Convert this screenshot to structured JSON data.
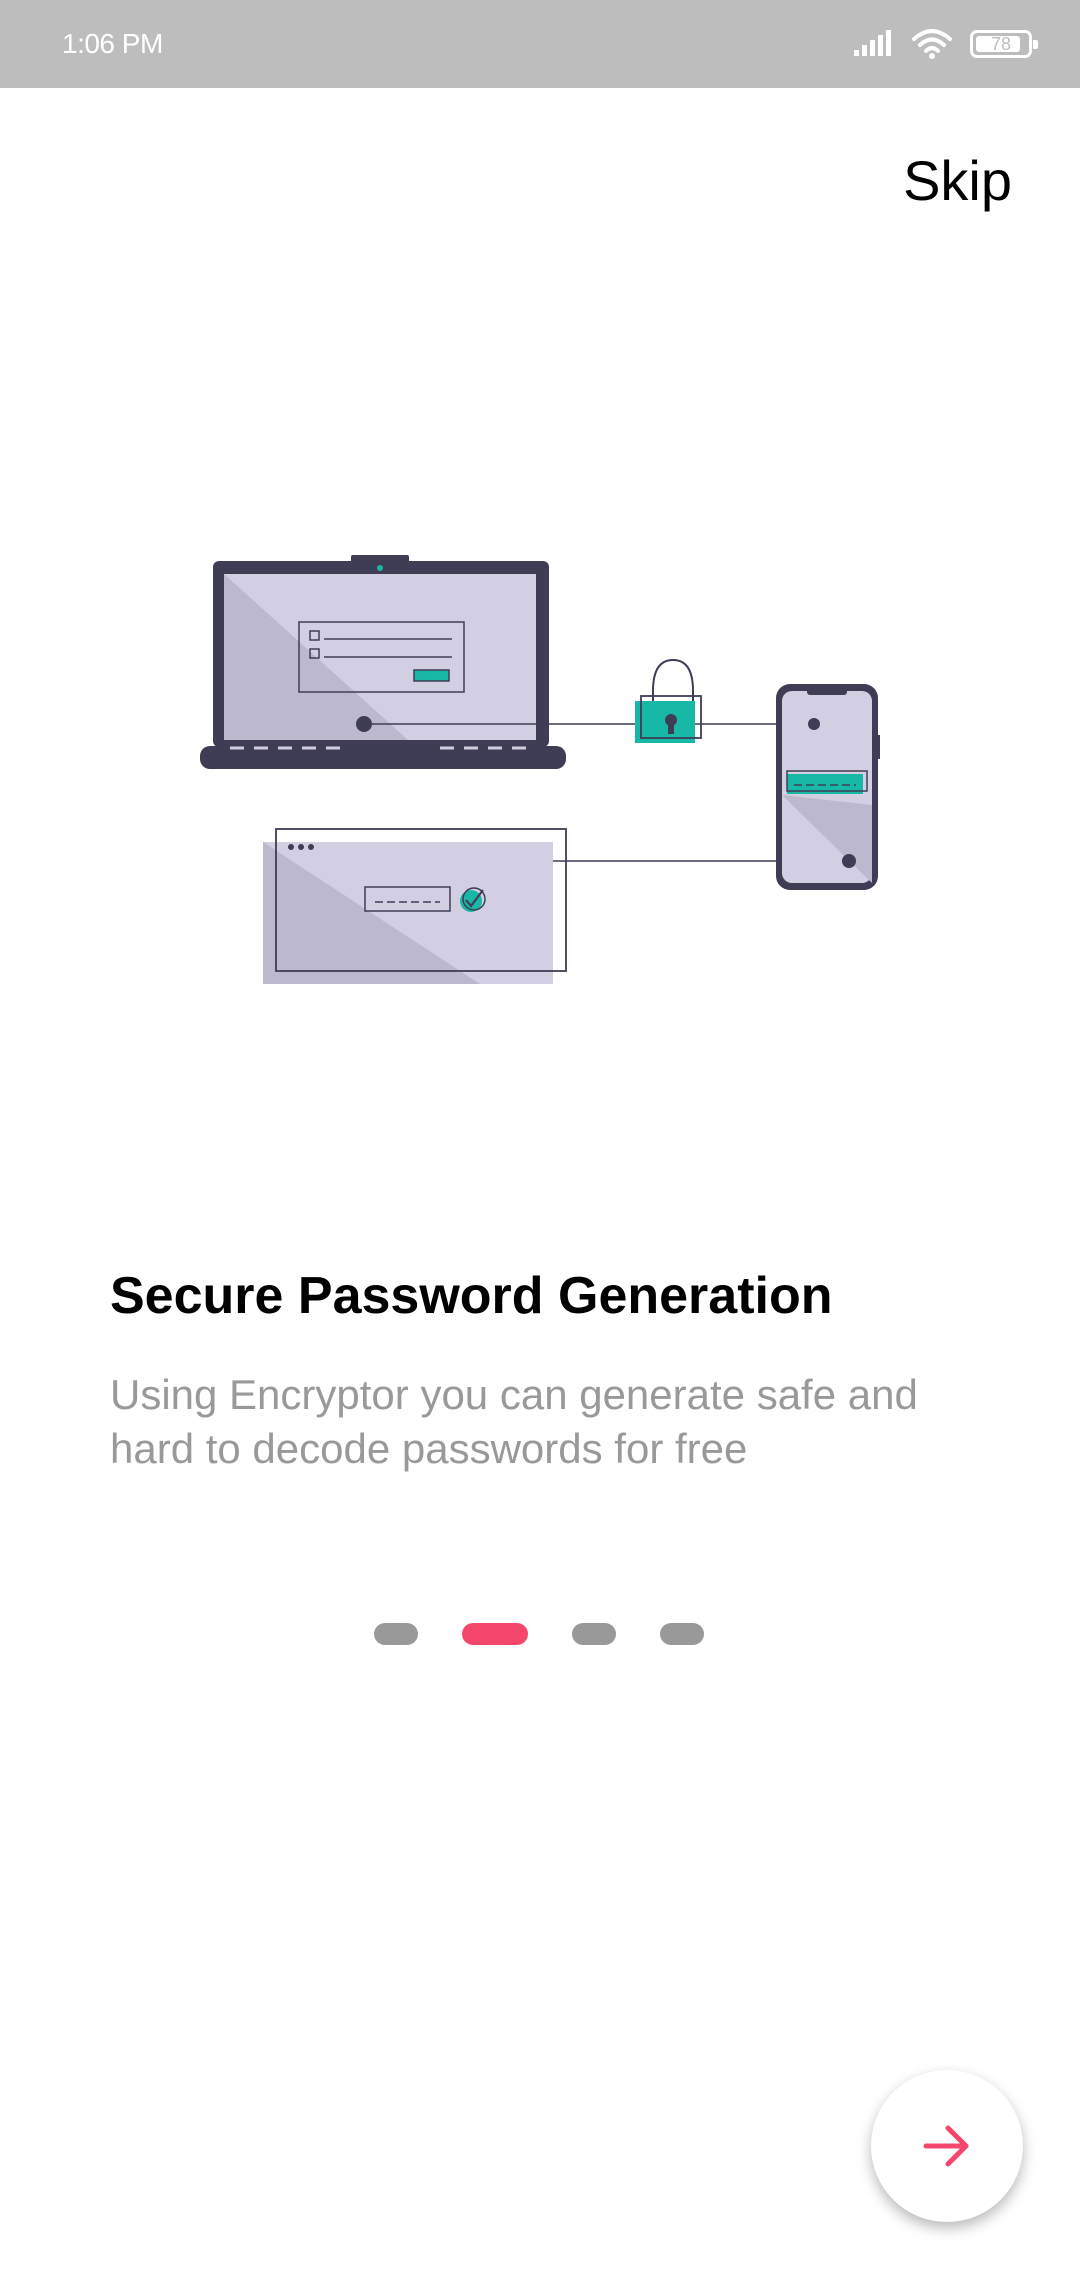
{
  "status_bar": {
    "time": "1:06 PM",
    "battery": "78",
    "icons": [
      "signal-icon",
      "wifi-icon",
      "battery-icon"
    ]
  },
  "header": {
    "skip_label": "Skip"
  },
  "onboarding": {
    "illustration": "secure-password-illustration",
    "title": "Secure Password Generation",
    "description": "Using Encryptor you can generate safe and hard to decode passwords for free",
    "page_indicator": {
      "total": 4,
      "current": 2
    },
    "next_icon": "arrow-right-icon"
  },
  "colors": {
    "accent": "#f5476c",
    "teal": "#17b8a6",
    "dark": "#3f3d56",
    "muted": "#999999",
    "status_bar": "#bdbdbd"
  }
}
